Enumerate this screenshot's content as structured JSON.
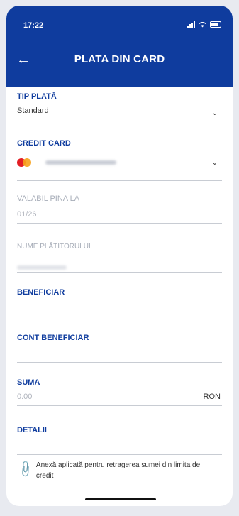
{
  "status_bar": {
    "time": "17:22"
  },
  "header": {
    "title": "PLATA DIN CARD"
  },
  "fields": {
    "tip_plata": {
      "label": "TIP PLATĂ",
      "value": "Standard"
    },
    "credit_card": {
      "label": "CREDIT CARD"
    },
    "valabil": {
      "label": "VALABIL PINA LA",
      "value": "01/26"
    },
    "nume": {
      "label": "NUME PLĂTITORULUI"
    },
    "beneficiar": {
      "label": "BENEFICIAR"
    },
    "cont_beneficiar": {
      "label": "CONT BENEFICIAR"
    },
    "suma": {
      "label": "SUMA",
      "placeholder": "0.00",
      "currency": "RON"
    },
    "detalii": {
      "label": "DETALII"
    }
  },
  "annex": {
    "text": "Anexă aplicată pentru retragerea sumei din limita de credit"
  },
  "colors": {
    "brand": "#0f3c9e",
    "mastercard_red": "#e31e24",
    "mastercard_orange": "#f7a21b"
  }
}
